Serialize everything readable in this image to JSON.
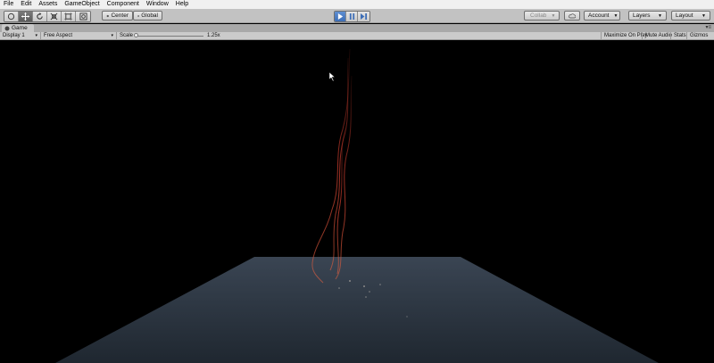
{
  "menu": [
    "File",
    "Edit",
    "Assets",
    "GameObject",
    "Component",
    "Window",
    "Help"
  ],
  "toolbar": {
    "tools": [
      "hand-tool",
      "move-tool",
      "rotate-tool",
      "scale-tool",
      "rect-tool",
      "transform-tool"
    ],
    "pivot_label": "Center",
    "space_label": "Global",
    "collab_label": "Collab",
    "account_label": "Account",
    "layers_label": "Layers",
    "layout_label": "Layout"
  },
  "game_view": {
    "tab_label": "Game",
    "display_label": "Display 1",
    "aspect_label": "Free Aspect",
    "scale_label": "Scale",
    "scale_value": "1.25x",
    "scale_fraction": 0.02,
    "maximize_label": "Maximize On Play",
    "mute_label": "Mute Audio",
    "stats_label": "Stats",
    "gizmos_label": "Gizmos"
  },
  "colors": {
    "play_active": "#3c6db6",
    "plane_top": "#3a4553",
    "plane_bottom": "#1f2730",
    "particle_trail": "#c0392b"
  }
}
